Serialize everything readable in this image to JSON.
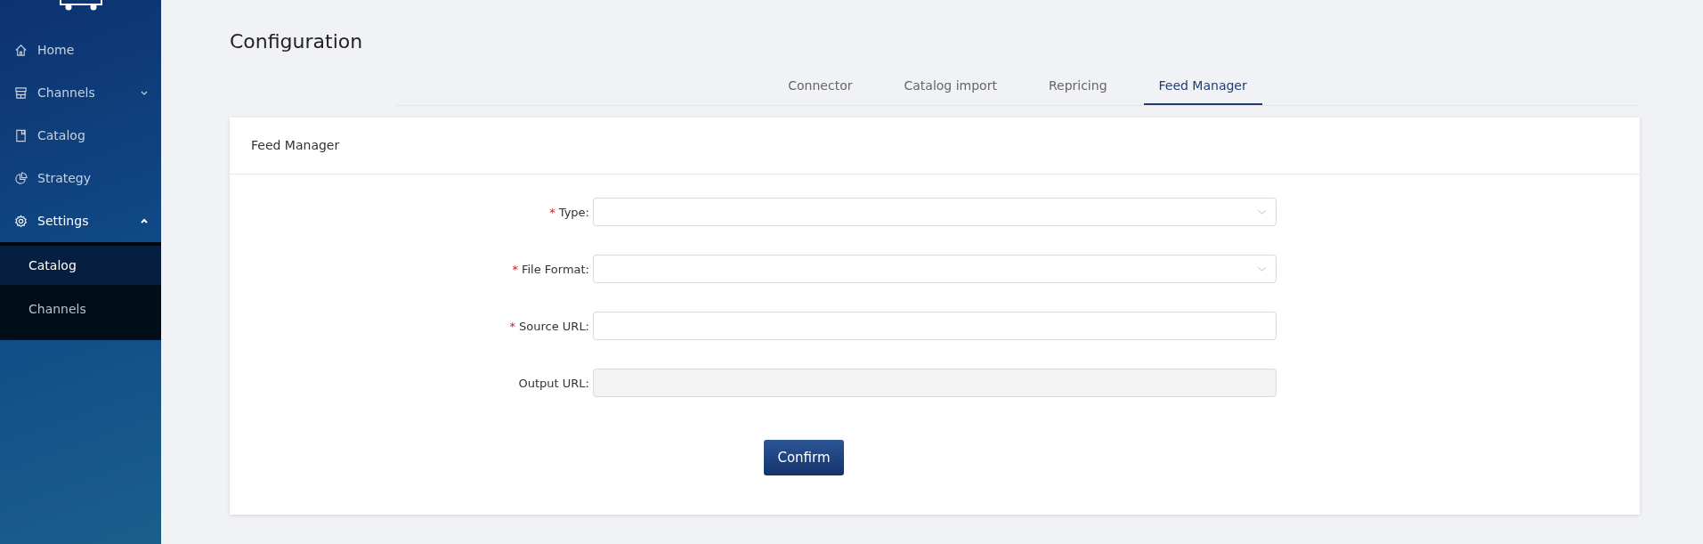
{
  "sidebar": {
    "items": [
      {
        "label": "Home",
        "selected": false
      },
      {
        "label": "Channels",
        "selected": false,
        "expanded": false
      },
      {
        "label": "Catalog",
        "selected": false
      },
      {
        "label": "Strategy",
        "selected": false
      },
      {
        "label": "Settings",
        "selected": false,
        "expanded": true,
        "children": [
          {
            "label": "Catalog",
            "selected": true
          },
          {
            "label": "Channels",
            "selected": false
          }
        ]
      }
    ]
  },
  "page": {
    "title": "Configuration"
  },
  "tabs": [
    {
      "label": "Connector",
      "selected": false
    },
    {
      "label": "Catalog import",
      "selected": false
    },
    {
      "label": "Repricing",
      "selected": false
    },
    {
      "label": "Feed Manager",
      "selected": true
    }
  ],
  "card": {
    "title": "Feed Manager",
    "fields": [
      {
        "required_mark": "*",
        "label": "Type:",
        "kind": "select"
      },
      {
        "required_mark": "*",
        "label": "File Format:",
        "kind": "select"
      },
      {
        "required_mark": "*",
        "label": "Source URL:",
        "kind": "input"
      },
      {
        "label": "Output URL:",
        "kind": "readonly"
      }
    ],
    "button": "Confirm"
  }
}
